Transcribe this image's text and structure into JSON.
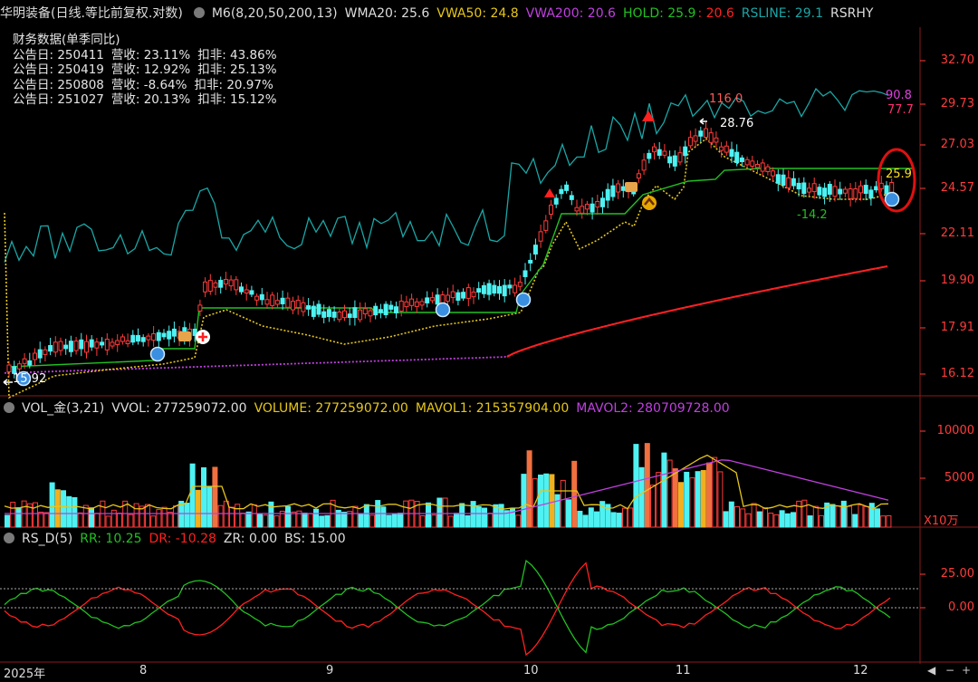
{
  "price_header": {
    "title": "华明装备(日线.等比前复权.对数)",
    "m6": "M6(8,20,50,200,13)",
    "wma20": "WMA20: 25.6",
    "vwa50": "VWA50: 24.8",
    "vwa200": "VWA200: 20.6",
    "hold_a": "HOLD: 25.9",
    "hold_b": ": 20.6",
    "rsline": "RSLINE: 29.1",
    "rsrhy": "RSRHY"
  },
  "fin_data": {
    "title": "财务数据(单季同比)",
    "rows": [
      {
        "date": "公告日: 250411",
        "rev": "营收:  23.11%",
        "ded": "扣非:  43.86%"
      },
      {
        "date": "公告日: 250419",
        "rev": "营收:  12.92%",
        "ded": "扣非:  25.13%"
      },
      {
        "date": "公告日: 250808",
        "rev": "营收:  -8.64%",
        "ded": "扣非:  20.97%"
      },
      {
        "date": "公告日: 251027",
        "rev": "营收:  20.13%",
        "ded": "扣非:  15.12%"
      }
    ]
  },
  "price_axis": [
    "32.70",
    "29.73",
    "27.03",
    "24.57",
    "22.11",
    "19.90",
    "17.91",
    "16.12"
  ],
  "price_labels": {
    "high": "116.0",
    "high_price": "28.76",
    "low": "15.92",
    "rs_a": "90.8",
    "rs_b": "77.7",
    "hold": "25.9",
    "dip": "-14.2"
  },
  "vol_header": {
    "name": "VOL_金(3,21)",
    "vvol": "VVOL: 277259072.00",
    "volume": "VOLUME: 277259072.00",
    "mavol1": "MAVOL1: 215357904.00",
    "mavol2": "MAVOL2: 280709728.00"
  },
  "vol_axis": [
    "10000",
    "5000"
  ],
  "vol_unit": "X10万",
  "rs_header": {
    "name": "RS_D(5)",
    "rr": "RR: 10.25",
    "dr": "DR: -10.28",
    "zr": "ZR: 0.00",
    "bs": "BS: 15.00"
  },
  "rs_axis": [
    "25.00",
    "0.00"
  ],
  "x_axis": [
    "2025年",
    "8",
    "9",
    "10",
    "11",
    "12"
  ],
  "colors": {
    "up": "#ff3b3b",
    "down": "#4ef2f2",
    "wma": "#22c022",
    "vwa50": "#e6c619",
    "vwa200": "#c040e0",
    "rsline": "#1aa6a6",
    "hold_red": "#ff2020"
  }
}
